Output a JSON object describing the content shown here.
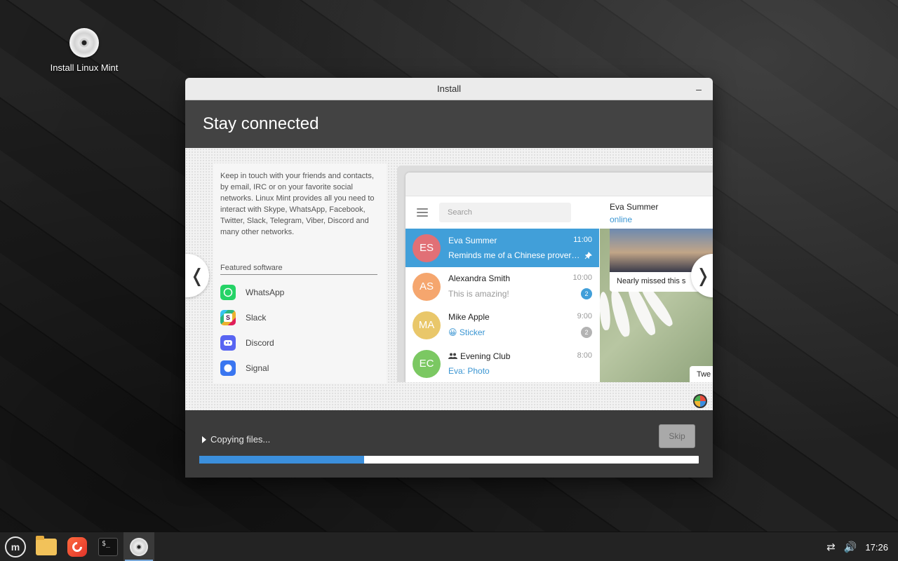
{
  "desktop": {
    "icon_label": "Install Linux Mint"
  },
  "window": {
    "title": "Install",
    "minimize": "–"
  },
  "slide": {
    "title": "Stay connected",
    "description": "Keep in touch with your friends and contacts, by email, IRC or on your favorite social networks. Linux Mint provides all you need to interact with Skype, WhatsApp, Facebook, Twitter, Slack, Telegram, Viber, Discord and many other networks.",
    "featured_title": "Featured software",
    "apps": [
      {
        "label": "WhatsApp",
        "icon": "whatsapp-icon",
        "color": "#25d366"
      },
      {
        "label": "Slack",
        "icon": "slack-icon",
        "color": "#4a154b"
      },
      {
        "label": "Discord",
        "icon": "discord-icon",
        "color": "#5865f2"
      },
      {
        "label": "Signal",
        "icon": "signal-icon",
        "color": "#3a76f0"
      }
    ],
    "prev_arrow": "❬",
    "next_arrow": "❭"
  },
  "telegram": {
    "search_placeholder": "Search",
    "chats": [
      {
        "initials": "ES",
        "name": "Eva Summer",
        "time": "11:00",
        "message": "Reminds me of a Chinese prover…",
        "color": "#e17076",
        "active": true
      },
      {
        "initials": "AS",
        "name": "Alexandra Smith",
        "time": "10:00",
        "message": "This is amazing!",
        "badge": "2",
        "color": "#f5a66e"
      },
      {
        "initials": "MA",
        "name": "Mike Apple",
        "time": "9:00",
        "message": "Sticker",
        "emoji": "😀",
        "badge": "2",
        "color": "#e9c76a"
      },
      {
        "initials": "EC",
        "name": "Evening Club",
        "time": "8:00",
        "message": "Eva: Photo",
        "color": "#7bc862"
      }
    ],
    "conversation": {
      "name": "Eva Summer",
      "status": "online",
      "photo_caption": "Nearly missed this s",
      "bubble_text": "Twe"
    }
  },
  "progress": {
    "status": "Copying files...",
    "skip_label": "Skip",
    "fraction": 0.33
  },
  "taskbar": {
    "clock": "17:26",
    "terminal_prompt": "$_"
  },
  "colors": {
    "accent": "#3b8fdc",
    "active_chat": "#419fd9"
  }
}
